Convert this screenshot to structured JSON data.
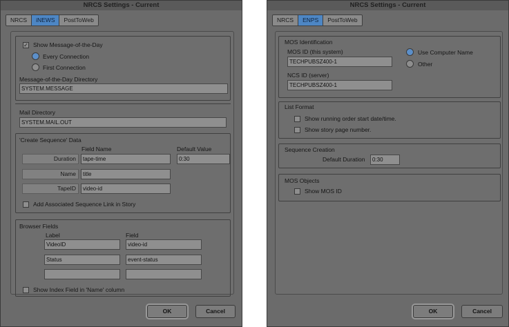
{
  "left": {
    "title": "NRCS Settings - Current",
    "tabs": [
      "NRCS",
      "iNEWS",
      "PostToWeb"
    ],
    "show_motd": "Show Message-of-the-Day",
    "every_connection": "Every Connection",
    "first_connection": "First Connection",
    "motd_dir_label": "Message-of-the-Day Directory",
    "motd_dir_value": "SYSTEM.MESSAGE",
    "mail_dir_label": "Mail Directory",
    "mail_dir_value": "SYSTEM.MAIL.OUT",
    "create_seq_title": "'Create Sequence' Data",
    "field_name_header": "Field Name",
    "default_value_header": "Default Value",
    "rows": [
      {
        "label": "Duration",
        "field": "tape-time",
        "default": "0:30"
      },
      {
        "label": "Name",
        "field": "title"
      },
      {
        "label": "TapeID",
        "field": "video-id"
      }
    ],
    "add_seq_link": "Add Associated Sequence Link in Story",
    "browser_title": "Browser Fields",
    "label_header": "Label",
    "field_header": "Field",
    "browser_rows": [
      {
        "label": "VideoID",
        "field": "video-id"
      },
      {
        "label": "Status",
        "field": "event-status"
      },
      {
        "label": "",
        "field": ""
      }
    ],
    "show_index": "Show Index Field in 'Name' column",
    "ok": "OK",
    "cancel": "Cancel"
  },
  "right": {
    "title": "NRCS Settings - Current",
    "tabs": [
      "NRCS",
      "ENPS",
      "PostToWeb"
    ],
    "mos_ident_title": "MOS Identification",
    "mos_id_label": "MOS ID (this system)",
    "mos_id_value": "TECHPUBSZ400-1",
    "ncs_id_label": "NCS ID (server)",
    "ncs_id_value": "TECHPUBSZ400-1",
    "use_computer_name": "Use Computer Name",
    "other": "Other",
    "list_format_title": "List Format",
    "show_running_order": "Show running order start date/time.",
    "show_story_page": "Show story page number.",
    "seq_creation_title": "Sequence Creation",
    "default_duration_label": "Default Duration",
    "default_duration_value": "0:30",
    "mos_objects_title": "MOS Objects",
    "show_mos_id": "Show MOS ID",
    "ok": "OK",
    "cancel": "Cancel"
  }
}
